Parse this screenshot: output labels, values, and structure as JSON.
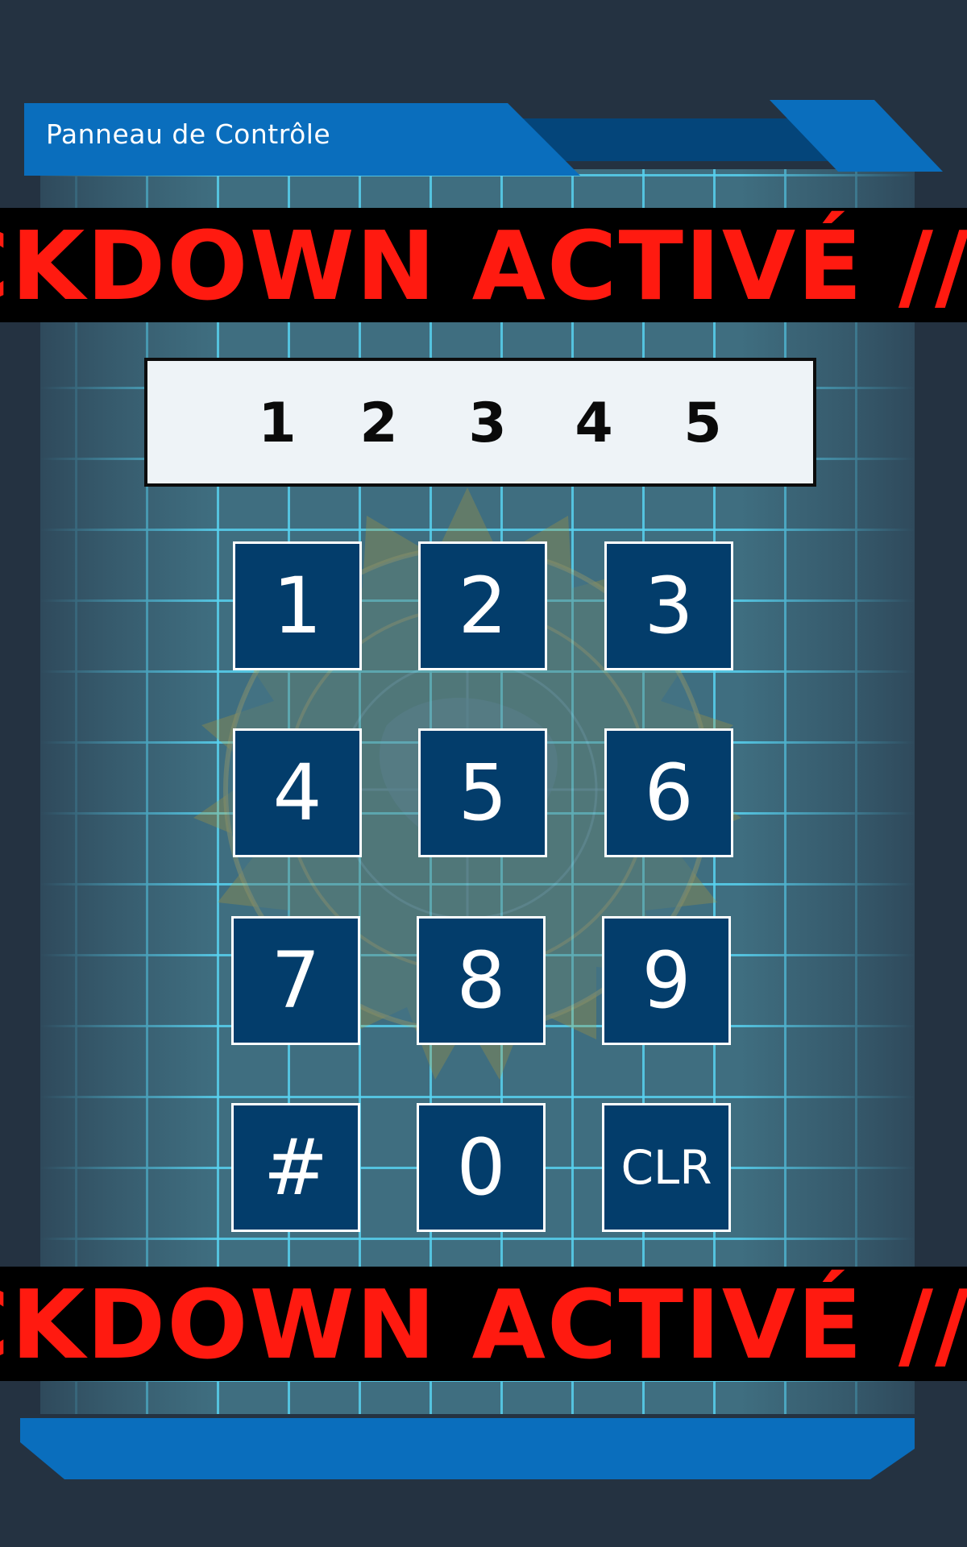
{
  "header": {
    "title": "Panneau de Contrôle"
  },
  "banners": {
    "top_text": "LOCKDOWN ACTIVÉ // LOCKDOWN ACTIVÉ //",
    "bottom_text": "LOCKDOWN ACTIVÉ // LOCKDOWN ACTIVÉ //"
  },
  "code_display": {
    "digits": [
      "1",
      "2",
      "3",
      "4",
      "5"
    ]
  },
  "keypad": {
    "keys": [
      "1",
      "2",
      "3",
      "4",
      "5",
      "6",
      "7",
      "8",
      "9",
      "#",
      "0",
      "CLR"
    ]
  },
  "colors": {
    "background": "#243241",
    "accent_blue": "#0a6ebd",
    "key_fill": "#033d6b",
    "grid_line": "#58d2f0",
    "alert_red": "#ff1a10",
    "banner_black": "#000000"
  },
  "icons": {
    "emblem": "agency-seal-icon"
  }
}
